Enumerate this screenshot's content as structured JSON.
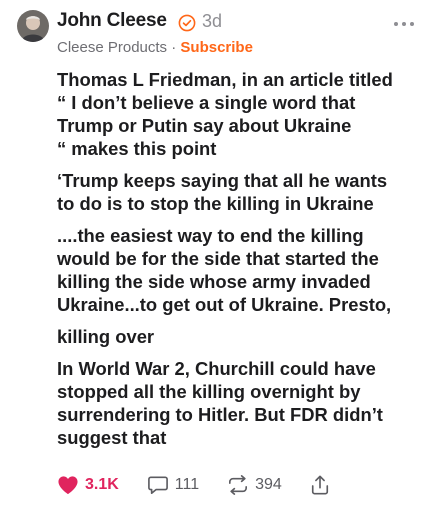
{
  "post": {
    "author": "John Cleese",
    "time": "3d",
    "publication": "Cleese Products",
    "separator": "·",
    "subscribe_label": "Subscribe",
    "paragraphs": [
      "Thomas L Friedman, in an article titled\n“ I don’t believe a single word that\nTrump or Putin say about Ukraine\n“ makes this point",
      "‘Trump keeps saying that all he wants\nto do is to stop the killing in Ukraine",
      "....the easiest way to end the killing\nwould be for the side that started the\nkilling the side whose army invaded\nUkraine...to get out of Ukraine. Presto,",
      "killing over",
      "In World War 2, Churchill could have\nstopped all the killing overnight by\nsurrendering to Hitler. But FDR didn’t\nsuggest that"
    ]
  },
  "actions": {
    "likes": "3.1K",
    "comments": "111",
    "restacks": "394"
  },
  "icons": {
    "verified": "verified-badge-icon",
    "more": "more-dots-icon",
    "like": "heart-icon",
    "comment": "comment-bubble-icon",
    "restack": "restack-arrows-icon",
    "share": "share-icon"
  },
  "colors": {
    "accent": "#ff6719",
    "like": "#e0245e",
    "muted": "#8e8e93",
    "text": "#1d1d1f"
  }
}
